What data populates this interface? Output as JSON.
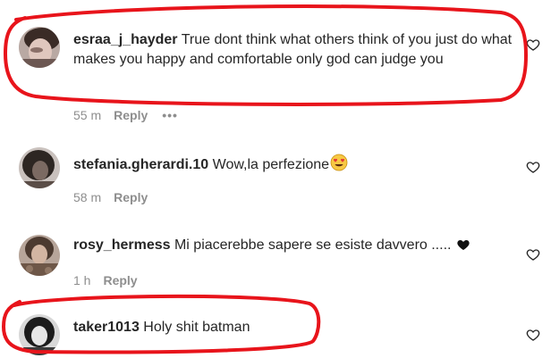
{
  "comments": [
    {
      "username": "esraa_j_hayder",
      "text": "True dont think what others think of you just do what makes you happy and comfortable only god can judge you",
      "time": "55 m",
      "reply_label": "Reply",
      "more_label": "•••",
      "avatar_icon": "profile-photo"
    },
    {
      "username": "stefania.gherardi.10",
      "text": "Wow,la perfezione",
      "emoji": "heart-eyes-emoji",
      "time": "58 m",
      "reply_label": "Reply",
      "avatar_icon": "profile-photo"
    },
    {
      "username": "rosy_hermess",
      "text": "Mi piacerebbe sapere se esiste davvero .....",
      "emoji": "black-heart",
      "time": "1 h",
      "reply_label": "Reply",
      "avatar_icon": "profile-photo"
    },
    {
      "username": "taker1013",
      "text": "Holy shit batman",
      "avatar_icon": "profile-photo"
    }
  ],
  "colors": {
    "annotation_red": "#e8141b",
    "meta_gray": "#8e8e8e",
    "text": "#262626"
  },
  "like_icon": "heart-outline-icon"
}
